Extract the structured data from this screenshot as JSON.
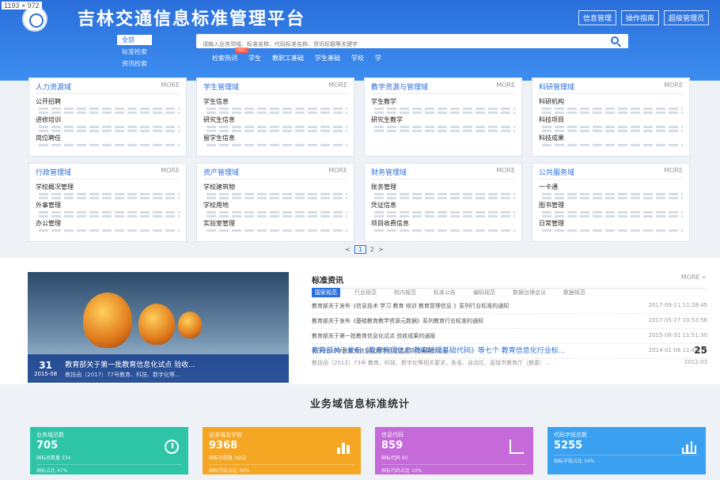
{
  "screen_size": "1193 × 972",
  "header": {
    "title": "吉林交通信息标准管理平台",
    "buttons": [
      "信息管理",
      "操作指南",
      "超级管理员"
    ],
    "search_categories": [
      "全部",
      "标准检索",
      "资讯检索"
    ],
    "search_placeholder": "请输入业务领域、标准名称、代码标准名称、资讯标题等关键字",
    "hot_label": "检索热词",
    "hot_badge": "HOT",
    "hot_words": [
      "学生",
      "教职工基础",
      "学生基础",
      "学校",
      "学"
    ]
  },
  "cards": [
    {
      "title": "人力资源域",
      "more": "MORE",
      "sections": [
        "公开招聘",
        "进修培训",
        "岗位聘任"
      ]
    },
    {
      "title": "学生管理域",
      "more": "MORE",
      "sections": [
        "学生信息",
        "研究生信息",
        "留学生信息"
      ]
    },
    {
      "title": "教学资源与管理域",
      "more": "MORE",
      "sections": [
        "学生教学",
        "研究生教学"
      ]
    },
    {
      "title": "科研管理域",
      "more": "MORE",
      "sections": [
        "科研机构",
        "科技项目",
        "科技成果"
      ]
    },
    {
      "title": "行政管理域",
      "more": "MORE",
      "sections": [
        "学校概况管理",
        "外事管理",
        "办公管理"
      ]
    },
    {
      "title": "资产管理域",
      "more": "MORE",
      "sections": [
        "学校建筑物",
        "学校用地",
        "实验室管理"
      ]
    },
    {
      "title": "财务管理域",
      "more": "MORE",
      "sections": [
        "账务管理",
        "凭证信息",
        "项目收费信息"
      ]
    },
    {
      "title": "公共服务域",
      "more": "MORE",
      "sections": [
        "一卡通",
        "图书管理",
        "日常管理"
      ]
    }
  ],
  "pager": {
    "prev": "<",
    "current": "1",
    "next_page": "2",
    "next": ">"
  },
  "banner": {
    "day": "31",
    "ym": "2015-08",
    "title": "教育部关于第一批教育信息化试点 验收...",
    "subtitle": "教技函（2017）77号教育、科技、数字化等…"
  },
  "news": {
    "title": "标准资讯",
    "more": "MORE »",
    "tabs": [
      "国家规范",
      "行业规范",
      "校内规范",
      "标准公告",
      "编码规范",
      "数据治理会议",
      "数据规范"
    ],
    "rows": [
      {
        "text": "教育部关于发布《信息技术 学习 教育 培训 教育管理信息 》系列行业标准的通知",
        "date": "2017-09-11 11:28:45"
      },
      {
        "text": "教育部关于发布《基础教育教学资源元数据》系列教育行业标准的通知",
        "date": "2017-05-27 10:53:56"
      },
      {
        "text": "教育部关于第一批教育信息化试点 验收成果的通报",
        "date": "2015-08-31 11:51:30"
      },
      {
        "text": "关于2016年度教育信息化教学应用试点项目结果的公示",
        "date": "2014-01-06 11:44:15"
      }
    ],
    "feature_title": "教育部关于发布《教育管理信息 教育管理基础代码》等七个 教育信息化行业标...",
    "feature_day": "25",
    "feature_desc": "教技函〔2012〕73号 教育、科技、数字化等相关要求，各省、自治区、直辖市教育厅（教委）…",
    "feature_date": "2012-03"
  },
  "stats": {
    "title": "业务域信息标准统计",
    "items": [
      {
        "label": "业务域总数",
        "value": "705",
        "sub": "国标总数量 334",
        "sub2": "国标占比 47%",
        "color": "#2ec4a6",
        "icon": "clock-icon"
      },
      {
        "label": "业务域总字段",
        "value": "9368",
        "sub": "国标字段数 3662",
        "sub2": "国标字段占比 39%",
        "color": "#f5a623",
        "icon": "bar-chart-icon"
      },
      {
        "label": "信息代码",
        "value": "859",
        "sub": "国标代码 90",
        "sub2": "国标代码占比 10%",
        "color": "#c56ad8",
        "icon": "line-chart-icon"
      },
      {
        "label": "代码字段总数",
        "value": "5255",
        "sub": "",
        "sub2": "国标字段占比 34%",
        "color": "#3aa0f0",
        "icon": "column-chart-icon"
      }
    ]
  }
}
